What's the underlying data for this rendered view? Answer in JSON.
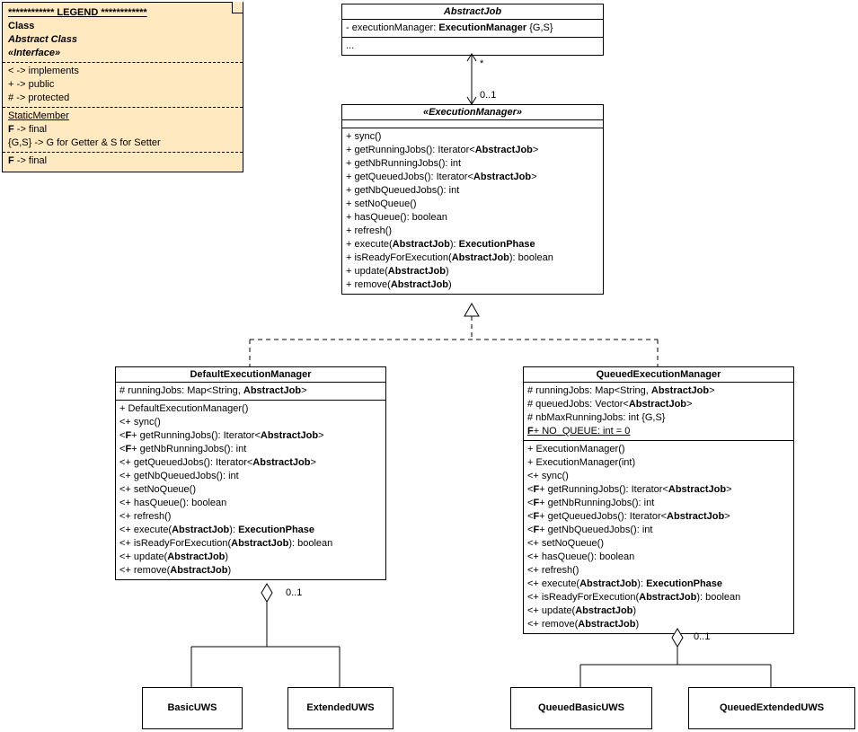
{
  "legend": {
    "title": "************ LEGEND ************",
    "class": "Class",
    "abstract": "Abstract Class",
    "interface": "«Interface»",
    "impl": "< -> implements",
    "public": "+ -> public",
    "protected": "# -> protected",
    "static": "StaticMember",
    "final1": "F -> final",
    "gs": "{G,S} -> G for Getter & S for Setter",
    "final2": "F -> final"
  },
  "abstractJob": {
    "title": "AbstractJob",
    "a1a": "- executionManager: ",
    "a1b": "ExecutionManager",
    "a1c": " {G,S}",
    "more": "..."
  },
  "execMgr": {
    "title": "«ExecutionManager»",
    "m1": "+ sync()",
    "m2a": "+ getRunningJobs(): Iterator<",
    "m2b": "AbstractJob",
    "m2c": ">",
    "m3": "+ getNbRunningJobs(): int",
    "m4a": "+ getQueuedJobs(): Iterator<",
    "m4b": "AbstractJob",
    "m4c": ">",
    "m5": "+ getNbQueuedJobs(): int",
    "m6": "+ setNoQueue()",
    "m7": "+ hasQueue(): boolean",
    "m8": "+ refresh()",
    "m9a": "+ execute(",
    "m9b": "AbstractJob",
    "m9c": "): ",
    "m9d": "ExecutionPhase",
    "m10a": "+ isReadyForExecution(",
    "m10b": "AbstractJob",
    "m10c": "): boolean",
    "m11a": "+ update(",
    "m11b": "AbstractJob",
    "m11c": ")",
    "m12a": "+ remove(",
    "m12b": "AbstractJob",
    "m12c": ")"
  },
  "defMgr": {
    "title": "DefaultExecutionManager",
    "a1a": "# runningJobs: Map<String, ",
    "a1b": "AbstractJob",
    "a1c": ">",
    "m1": "+ DefaultExecutionManager()",
    "m2": "<+ sync()",
    "m3a": "<",
    "m3b": "F",
    "m3c": "+ getRunningJobs(): Iterator<",
    "m3d": "AbstractJob",
    "m3e": ">",
    "m4a": "<",
    "m4b": "F",
    "m4c": "+ getNbRunningJobs(): int",
    "m5a": "<+ getQueuedJobs(): Iterator<",
    "m5b": "AbstractJob",
    "m5c": ">",
    "m6": "<+ getNbQueuedJobs(): int",
    "m7": "<+ setNoQueue()",
    "m8": "<+ hasQueue(): boolean",
    "m9": "<+ refresh()",
    "m10a": "<+ execute(",
    "m10b": "AbstractJob",
    "m10c": "): ",
    "m10d": "ExecutionPhase",
    "m11a": "<+ isReadyForExecution(",
    "m11b": "AbstractJob",
    "m11c": "): boolean",
    "m12a": "<+ update(",
    "m12b": "AbstractJob",
    "m12c": ")",
    "m13a": "<+ remove(",
    "m13b": "AbstractJob",
    "m13c": ")"
  },
  "qMgr": {
    "title": "QueuedExecutionManager",
    "a1a": "# runningJobs: Map<String, ",
    "a1b": "AbstractJob",
    "a1c": ">",
    "a2a": "# queuedJobs: Vector<",
    "a2b": "AbstractJob",
    "a2c": ">",
    "a3": "# nbMaxRunningJobs: int {G,S}",
    "a4a": "F",
    "a4b": "+ NO_QUEUE: int = 0",
    "m1": "+ ExecutionManager()",
    "m2": "+ ExecutionManager(int)",
    "m3": "<+ sync()",
    "m4a": "<",
    "m4b": "F",
    "m4c": "+ getRunningJobs(): Iterator<",
    "m4d": "AbstractJob",
    "m4e": ">",
    "m5a": "<",
    "m5b": "F",
    "m5c": "+ getNbRunningJobs(): int",
    "m6a": "<",
    "m6b": "F",
    "m6c": "+ getQueuedJobs(): Iterator<",
    "m6d": "AbstractJob",
    "m6e": ">",
    "m7a": "<",
    "m7b": "F",
    "m7c": "+ getNbQueuedJobs(): int",
    "m8": "<+ setNoQueue()",
    "m9": "<+ hasQueue(): boolean",
    "m10": "<+ refresh()",
    "m11a": "<+ execute(",
    "m11b": "AbstractJob",
    "m11c": "): ",
    "m11d": "ExecutionPhase",
    "m12a": "<+ isReadyForExecution(",
    "m12b": "AbstractJob",
    "m12c": "): boolean",
    "m13a": "<+ update(",
    "m13b": "AbstractJob",
    "m13c": ")",
    "m14a": "<+ remove(",
    "m14b": "AbstractJob",
    "m14c": ")"
  },
  "simple": {
    "basic": "BasicUWS",
    "extended": "ExtendedUWS",
    "qbasic": "QueuedBasicUWS",
    "qextended": "QueuedExtendedUWS"
  },
  "mult": {
    "star": "*",
    "one": "0..1",
    "one2": "0..1",
    "one3": "0..1"
  }
}
